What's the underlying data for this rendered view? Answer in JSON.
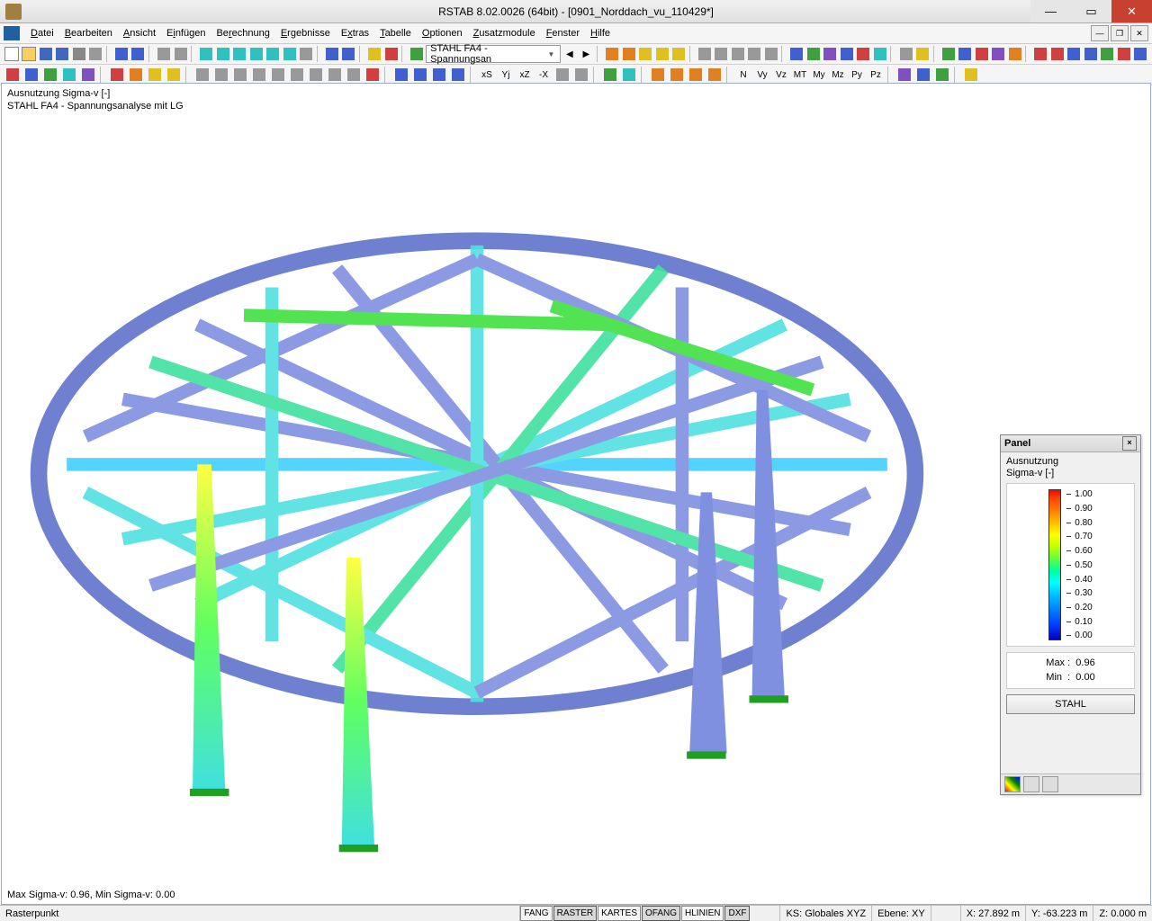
{
  "title": "RSTAB 8.02.0026 (64bit) - [0901_Norddach_vu_110429*]",
  "menu": [
    "Datei",
    "Bearbeiten",
    "Ansicht",
    "Einfügen",
    "Berechnung",
    "Ergebnisse",
    "Extras",
    "Tabelle",
    "Optionen",
    "Zusatzmodule",
    "Fenster",
    "Hilfe"
  ],
  "combo1": "STAHL FA4 - Spannungsan",
  "viewport": {
    "line1": "Ausnutzung Sigma-v [-]",
    "line2": "STAHL FA4 - Spannungsanalyse mit LG",
    "footer": "Max Sigma-v: 0.96, Min Sigma-v: 0.00"
  },
  "panel": {
    "title": "Panel",
    "sub1": "Ausnutzung",
    "sub2": "Sigma-v [-]",
    "ticks": [
      "1.00",
      "0.90",
      "0.80",
      "0.70",
      "0.60",
      "0.50",
      "0.40",
      "0.30",
      "0.20",
      "0.10",
      "0.00"
    ],
    "maxLabel": "Max",
    "maxVal": "0.96",
    "minLabel": "Min",
    "minVal": "0.00",
    "button": "STAHL"
  },
  "status": {
    "left": "Rasterpunkt",
    "toggles": [
      "FANG",
      "RASTER",
      "KARTES",
      "OFANG",
      "HLINIEN",
      "DXF"
    ],
    "ks": "KS: Globales XYZ",
    "ebene": "Ebene: XY",
    "x": "X:  27.892 m",
    "y": "Y:  -63.223 m",
    "z": "Z:  0.000 m"
  }
}
